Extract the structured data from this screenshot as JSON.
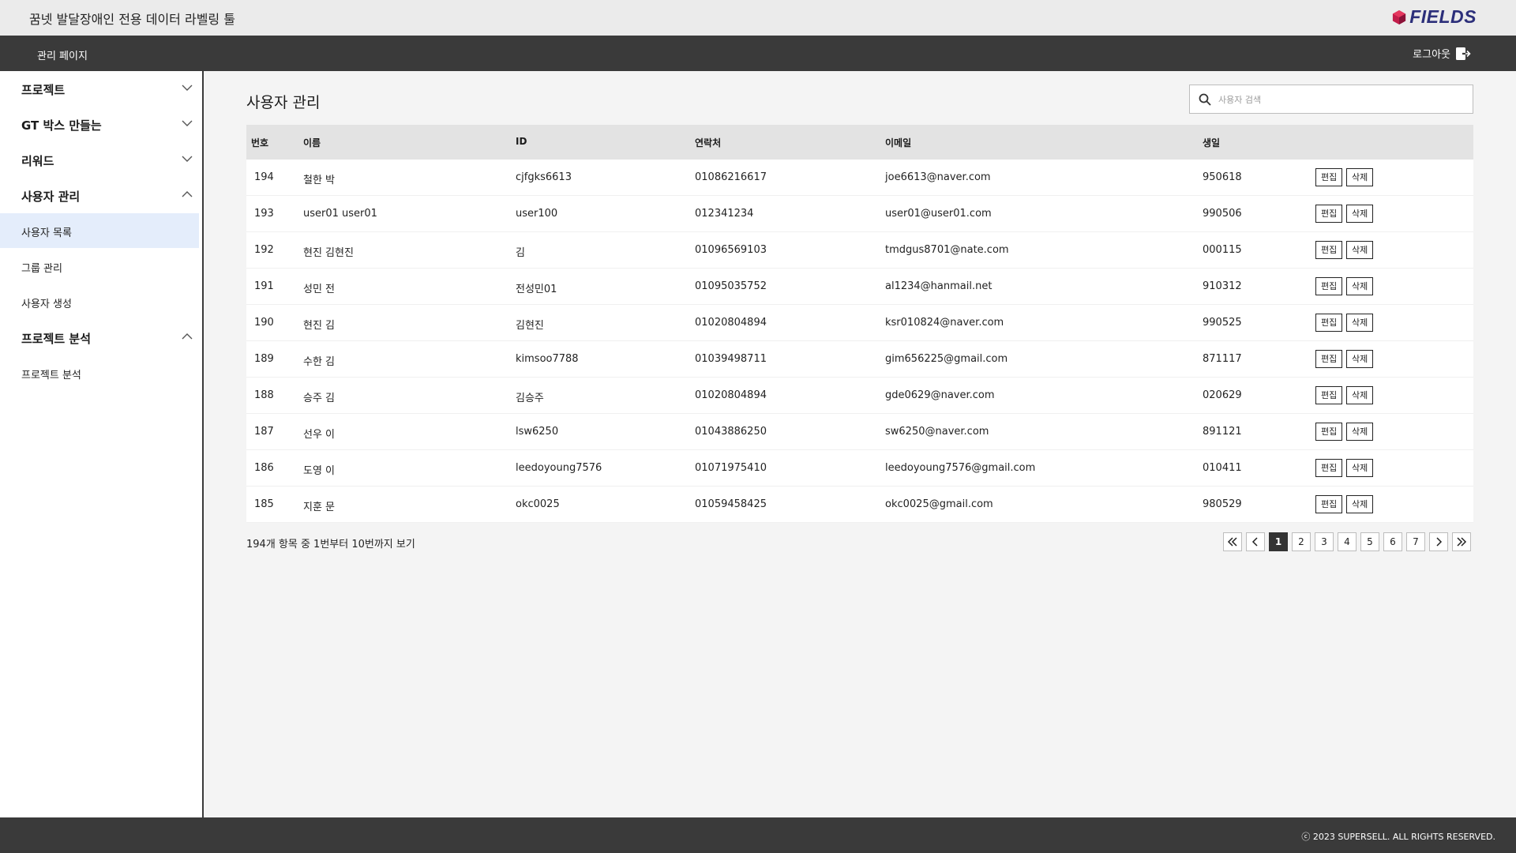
{
  "header": {
    "app_title": "꿈넷 발달장애인 전용 데이터 라벨링 툴",
    "logo_text": "FIELDS",
    "brand_color": "#2c2f7a"
  },
  "nav": {
    "title": "관리 페이지",
    "logout_label": "로그아웃",
    "logout_icon": "logout-icon"
  },
  "sidebar": {
    "sections": [
      {
        "label": "프로젝트",
        "expanded": false,
        "items": []
      },
      {
        "label": "GT 박스 만들는",
        "expanded": false,
        "items": []
      },
      {
        "label": "리워드",
        "expanded": false,
        "items": []
      },
      {
        "label": "사용자 관리",
        "expanded": true,
        "items": [
          {
            "label": "사용자 목록",
            "active": true
          },
          {
            "label": "그룹 관리",
            "active": false
          },
          {
            "label": "사용자 생성",
            "active": false
          }
        ]
      },
      {
        "label": "프로젝트 분석",
        "expanded": true,
        "items": [
          {
            "label": "프로젝트 분석",
            "active": false
          }
        ]
      }
    ]
  },
  "main": {
    "title": "사용자 관리",
    "search": {
      "placeholder": "사용자 검색",
      "value": "",
      "icon": "search-icon"
    },
    "table": {
      "columns": [
        "번호",
        "이름",
        "ID",
        "연락처",
        "이메일",
        "생일"
      ],
      "edit_label": "편집",
      "delete_label": "삭제",
      "rows": [
        {
          "no": "194",
          "name": "철한 박",
          "id": "cjfgks6613",
          "phone": "01086216617",
          "email": "joe6613@naver.com",
          "birth": "950618"
        },
        {
          "no": "193",
          "name": "user01 user01",
          "id": "user100",
          "phone": "012341234",
          "email": "user01@user01.com",
          "birth": "990506"
        },
        {
          "no": "192",
          "name": "현진 김현진",
          "id": "김",
          "phone": "01096569103",
          "email": "tmdgus8701@nate.com",
          "birth": "000115"
        },
        {
          "no": "191",
          "name": "성민 전",
          "id": "전성민01",
          "phone": "01095035752",
          "email": "al1234@hanmail.net",
          "birth": "910312"
        },
        {
          "no": "190",
          "name": "현진 김",
          "id": "김현진",
          "phone": "01020804894",
          "email": "ksr010824@naver.com",
          "birth": "990525"
        },
        {
          "no": "189",
          "name": "수한 김",
          "id": "kimsoo7788",
          "phone": "01039498711",
          "email": "gim656225@gmail.com",
          "birth": "871117"
        },
        {
          "no": "188",
          "name": "승주 김",
          "id": "김승주",
          "phone": "01020804894",
          "email": "gde0629@naver.com",
          "birth": "020629"
        },
        {
          "no": "187",
          "name": "선우 이",
          "id": "lsw6250",
          "phone": "01043886250",
          "email": "sw6250@naver.com",
          "birth": "891121"
        },
        {
          "no": "186",
          "name": "도영 이",
          "id": "leedoyoung7576",
          "phone": "01071975410",
          "email": "leedoyoung7576@gmail.com",
          "birth": "010411"
        },
        {
          "no": "185",
          "name": "지훈 문",
          "id": "okc0025",
          "phone": "01059458425",
          "email": "okc0025@gmail.com",
          "birth": "980529"
        }
      ]
    },
    "summary": "194개 항목 중 1번부터 10번까지 보기",
    "pagination": {
      "current": 1,
      "pages": [
        "1",
        "2",
        "3",
        "4",
        "5",
        "6",
        "7"
      ]
    }
  },
  "footer": {
    "copyright": "ⓒ 2023 SUPERSELL. ALL RIGHTS RESERVED."
  }
}
